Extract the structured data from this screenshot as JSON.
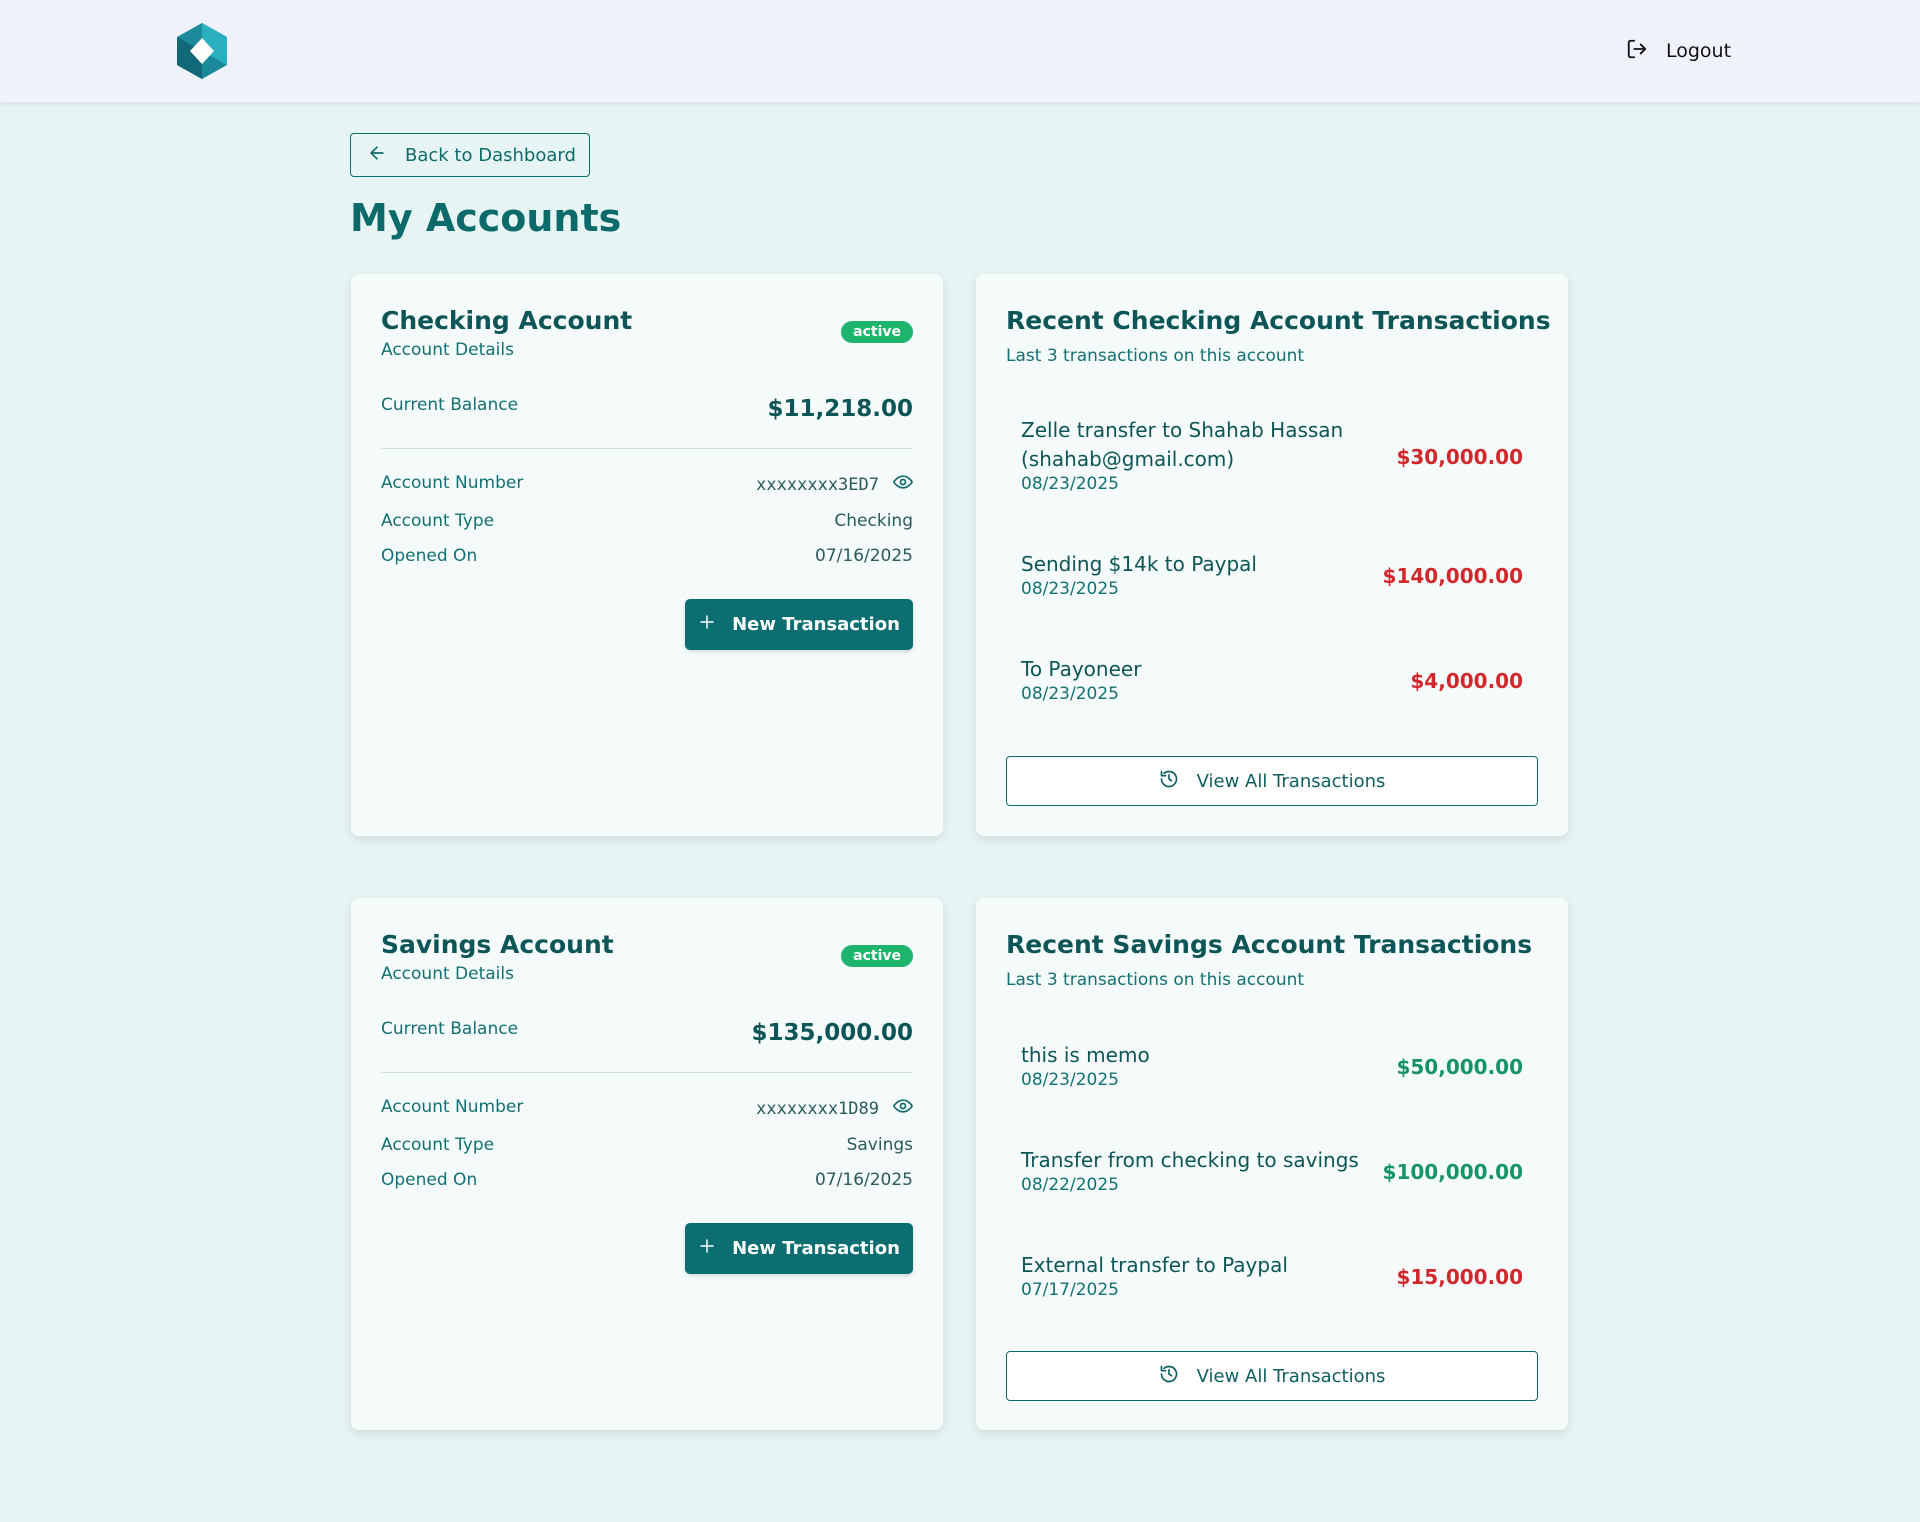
{
  "header": {
    "logo_icon": "hexagon-logo-icon",
    "logout_label": "Logout",
    "logout_icon": "logout-icon"
  },
  "back_button": {
    "label": "Back to Dashboard",
    "icon": "arrow-left-icon"
  },
  "page_title": "My Accounts",
  "colors": {
    "primary": "#0d6e71",
    "background": "#e6f4f3",
    "badge_active": "#1db56d",
    "negative_amount": "#d0282c",
    "positive_amount": "#169464"
  },
  "accounts": [
    {
      "title": "Checking Account",
      "subtitle": "Account Details",
      "status": "active",
      "balance_label": "Current Balance",
      "balance": "$11,218.00",
      "number_label": "Account Number",
      "number": "xxxxxxxx3ED7",
      "type_label": "Account Type",
      "type": "Checking",
      "opened_label": "Opened On",
      "opened": "07/16/2025",
      "new_tx_label": "New Transaction"
    },
    {
      "title": "Savings Account",
      "subtitle": "Account Details",
      "status": "active",
      "balance_label": "Current Balance",
      "balance": "$135,000.00",
      "number_label": "Account Number",
      "number": "xxxxxxxx1D89",
      "type_label": "Account Type",
      "type": "Savings",
      "opened_label": "Opened On",
      "opened": "07/16/2025",
      "new_tx_label": "New Transaction"
    }
  ],
  "transactions_panels": [
    {
      "title": "Recent Checking Account Transactions",
      "subtitle": "Last 3 transactions on this account",
      "items": [
        {
          "description": "Zelle transfer to Shahab Hassan (shahab@gmail.com)",
          "date": "08/23/2025",
          "amount": "$30,000.00",
          "direction": "negative"
        },
        {
          "description": "Sending $14k to Paypal",
          "date": "08/23/2025",
          "amount": "$140,000.00",
          "direction": "negative"
        },
        {
          "description": "To Payoneer",
          "date": "08/23/2025",
          "amount": "$4,000.00",
          "direction": "negative"
        }
      ],
      "view_all_label": "View All Transactions"
    },
    {
      "title": "Recent Savings Account Transactions",
      "subtitle": "Last 3 transactions on this account",
      "items": [
        {
          "description": "this is memo",
          "date": "08/23/2025",
          "amount": "$50,000.00",
          "direction": "positive"
        },
        {
          "description": "Transfer from checking to savings",
          "date": "08/22/2025",
          "amount": "$100,000.00",
          "direction": "positive"
        },
        {
          "description": "External transfer to Paypal",
          "date": "07/17/2025",
          "amount": "$15,000.00",
          "direction": "negative"
        }
      ],
      "view_all_label": "View All Transactions"
    }
  ]
}
